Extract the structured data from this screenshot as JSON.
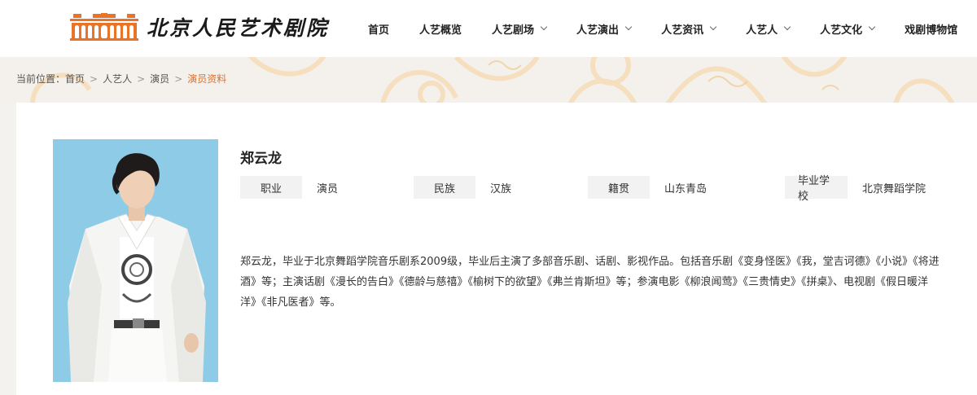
{
  "site": {
    "logo_text": "北京人民艺术剧院"
  },
  "nav": {
    "items": [
      {
        "label": "首页",
        "has_dropdown": false
      },
      {
        "label": "人艺概览",
        "has_dropdown": false
      },
      {
        "label": "人艺剧场",
        "has_dropdown": true
      },
      {
        "label": "人艺演出",
        "has_dropdown": true
      },
      {
        "label": "人艺资讯",
        "has_dropdown": true
      },
      {
        "label": "人艺人",
        "has_dropdown": true
      },
      {
        "label": "人艺文化",
        "has_dropdown": true
      },
      {
        "label": "戏剧博物馆",
        "has_dropdown": false
      }
    ]
  },
  "breadcrumb": {
    "prefix": "当前位置：",
    "items": [
      "首页",
      "人艺人",
      "演员"
    ],
    "current": "演员资料",
    "separator": ">"
  },
  "profile": {
    "name": "郑云龙",
    "fields": [
      {
        "label": "职业",
        "value": "演员"
      },
      {
        "label": "民族",
        "value": "汉族"
      },
      {
        "label": "籍贯",
        "value": "山东青岛"
      },
      {
        "label": "毕业学校",
        "value": "北京舞蹈学院"
      }
    ],
    "bio": "郑云龙，毕业于北京舞蹈学院音乐剧系2009级，毕业后主演了多部音乐剧、话剧、影视作品。包括音乐剧《变身怪医》《我，堂吉诃德》《小说》《将进酒》等；主演话剧《漫长的告白》《德龄与慈禧》《榆树下的欲望》《弗兰肯斯坦》等；参演电影《柳浪闻莺》《三贵情史》《拼桌》、电视剧《假日暖洋洋》《非凡医者》等。"
  },
  "colors": {
    "accent": "#e0702c",
    "logo_orange": "#e8742a",
    "photo_bg": "#8ecbe6",
    "label_bg": "#f2f2f2",
    "band_bg": "#f4f1ec"
  },
  "icons": {
    "logo": "theatre-building-logo",
    "dropdown": "chevron-down-icon",
    "breadcrumb_separator": "chevron-right-icon"
  }
}
